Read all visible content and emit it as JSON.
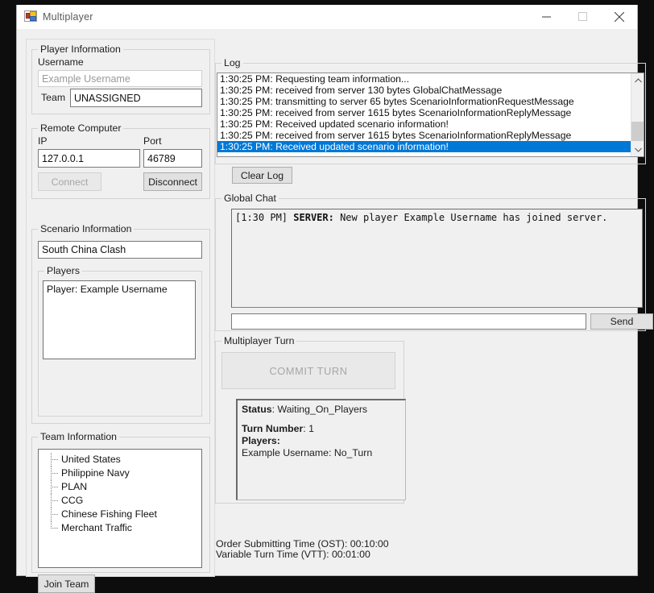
{
  "window": {
    "title": "Multiplayer",
    "icon": "winforms-app-icon",
    "minimize_label": "minimize-icon",
    "maximize_label": "maximize-icon",
    "close_label": "close-icon"
  },
  "player_information": {
    "group_title": "Player Information",
    "username_label": "Username",
    "username_value": "",
    "username_placeholder": "Example Username",
    "team_label": "Team",
    "team_value": "UNASSIGNED"
  },
  "remote_computer": {
    "group_title": "Remote Computer",
    "ip_label": "IP",
    "ip_value": "127.0.0.1",
    "port_label": "Port",
    "port_value": "46789",
    "connect_label": "Connect",
    "connect_enabled": false,
    "disconnect_label": "Disconnect"
  },
  "scenario_information": {
    "group_title": "Scenario Information",
    "scenario_name": "South China Clash",
    "players_group_title": "Players",
    "players": [
      "Player: Example Username"
    ]
  },
  "team_information": {
    "group_title": "Team Information",
    "teams": [
      "United States",
      "Philippine Navy",
      "PLAN",
      "CCG",
      "Chinese Fishing Fleet",
      "Merchant Traffic"
    ],
    "join_team_label": "Join Team"
  },
  "log": {
    "group_title": "Log",
    "entries": [
      {
        "text": "1:30:25 PM: Requesting team information...",
        "selected": false
      },
      {
        "text": "1:30:25 PM: received from server 130 bytes GlobalChatMessage",
        "selected": false
      },
      {
        "text": "1:30:25 PM: transmitting to server 65 bytes ScenarioInformationRequestMessage",
        "selected": false
      },
      {
        "text": "1:30:25 PM: received from server 1615 bytes ScenarioInformationReplyMessage",
        "selected": false
      },
      {
        "text": "1:30:25 PM: Received updated scenario information!",
        "selected": false
      },
      {
        "text": "1:30:25 PM: received from server 1615 bytes ScenarioInformationReplyMessage",
        "selected": false
      },
      {
        "text": "1:30:25 PM: Received updated scenario information!",
        "selected": true
      }
    ],
    "clear_log_label": "Clear Log",
    "selection_color": "#0078d7"
  },
  "global_chat": {
    "group_title": "Global Chat",
    "messages": [
      {
        "timestamp": "[1:30 PM]",
        "sender": "SERVER:",
        "body": "New player Example Username has joined server."
      }
    ],
    "input_value": "",
    "send_label": "Send"
  },
  "multiplayer_turn": {
    "group_title": "Multiplayer Turn",
    "commit_turn_label": "COMMIT TURN",
    "commit_enabled": false,
    "status_label": "Status",
    "status_value": "Waiting_On_Players",
    "turn_number_label": "Turn Number",
    "turn_number_value": "1",
    "players_label": "Players:",
    "player_states": [
      "Example Username: No_Turn"
    ]
  },
  "footer": {
    "ost_line": "Order Submitting Time (OST): 00:10:00",
    "vtt_line": "Variable Turn Time (VTT): 00:01:00"
  }
}
